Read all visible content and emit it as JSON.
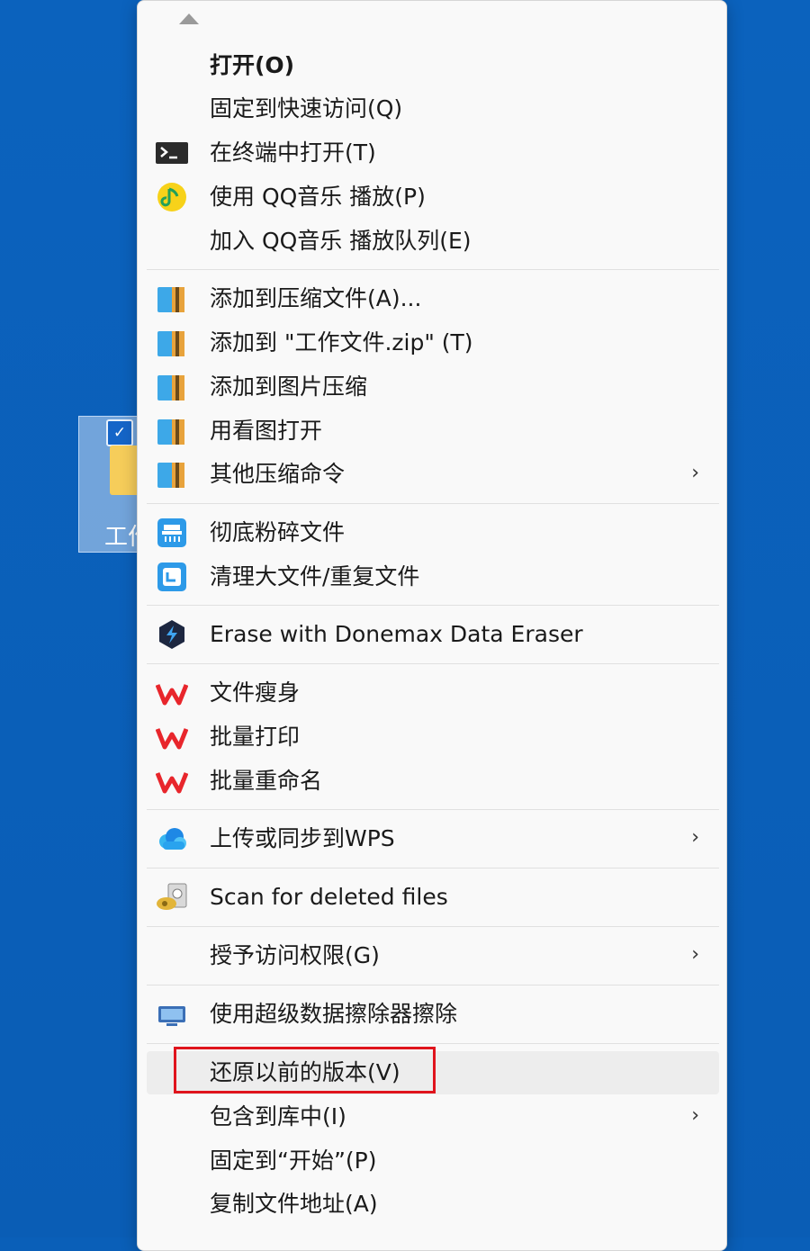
{
  "desktop": {
    "icon_label_partial": "工作",
    "check_mark": "✓"
  },
  "menu": {
    "chevron": "›",
    "items": [
      {
        "label": "打开(O)",
        "icon": "none",
        "bold": true
      },
      {
        "label": "固定到快速访问(Q)",
        "icon": "none"
      },
      {
        "label": "在终端中打开(T)",
        "icon": "terminal-icon"
      },
      {
        "label": "使用 QQ音乐 播放(P)",
        "icon": "qq-music-icon"
      },
      {
        "label": "加入 QQ音乐 播放队列(E)",
        "icon": "none"
      },
      {
        "label": "添加到压缩文件(A)...",
        "icon": "archive-icon"
      },
      {
        "label": "添加到 \"工作文件.zip\" (T)",
        "icon": "archive-icon"
      },
      {
        "label": "添加到图片压缩",
        "icon": "archive-icon"
      },
      {
        "label": "用看图打开",
        "icon": "archive-icon"
      },
      {
        "label": "其他压缩命令",
        "icon": "archive-icon",
        "submenu": true
      },
      {
        "label": "彻底粉碎文件",
        "icon": "shredder-icon"
      },
      {
        "label": "清理大文件/重复文件",
        "icon": "cleanup-icon"
      },
      {
        "label": "Erase with Donemax Data Eraser",
        "icon": "donemax-icon"
      },
      {
        "label": "文件瘦身",
        "icon": "wps-icon"
      },
      {
        "label": "批量打印",
        "icon": "wps-icon"
      },
      {
        "label": "批量重命名",
        "icon": "wps-icon"
      },
      {
        "label": "上传或同步到WPS",
        "icon": "cloud-icon",
        "submenu": true
      },
      {
        "label": "Scan for deleted files",
        "icon": "scan-icon"
      },
      {
        "label": "授予访问权限(G)",
        "icon": "none",
        "submenu": true
      },
      {
        "label": "使用超级数据擦除器擦除",
        "icon": "eraser-icon"
      },
      {
        "label": "还原以前的版本(V)",
        "icon": "none",
        "highlighted": true
      },
      {
        "label": "包含到库中(I)",
        "icon": "none",
        "submenu": true
      },
      {
        "label": "固定到“开始”(P)",
        "icon": "none"
      },
      {
        "label": "复制文件地址(A)",
        "icon": "none"
      }
    ]
  },
  "colors": {
    "desktop_bg": "#0a5fb8",
    "menu_bg": "#f9f9f9",
    "highlight_border": "#e0141d",
    "wps_red": "#e8262c",
    "archive_blue": "#3da8e8"
  }
}
